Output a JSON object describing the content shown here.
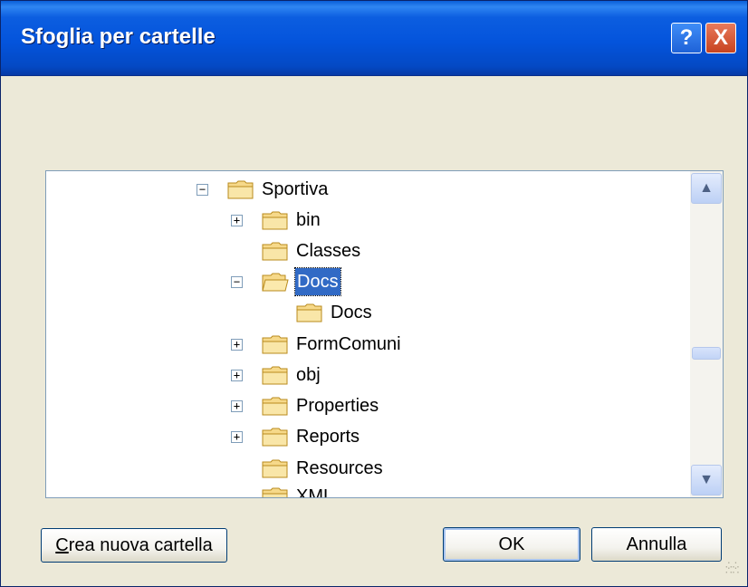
{
  "window": {
    "title": "Sfoglia per cartelle"
  },
  "titlebar_buttons": {
    "help": "?",
    "close": "X"
  },
  "tree": {
    "items": [
      {
        "label": "Sportiva",
        "expander": "−"
      },
      {
        "label": "bin",
        "expander": "+"
      },
      {
        "label": "Classes",
        "expander": ""
      },
      {
        "label": "Docs",
        "expander": "−",
        "selected": true
      },
      {
        "label": "Docs",
        "expander": ""
      },
      {
        "label": "FormComuni",
        "expander": "+"
      },
      {
        "label": "obj",
        "expander": "+"
      },
      {
        "label": "Properties",
        "expander": "+"
      },
      {
        "label": "Reports",
        "expander": "+"
      },
      {
        "label": "Resources",
        "expander": ""
      },
      {
        "label": "XML",
        "expander": ""
      }
    ]
  },
  "scrollbar": {
    "up": "▲",
    "down": "▼"
  },
  "buttons": {
    "create_prefix": "C",
    "create_rest": "rea nuova cartella",
    "ok": "OK",
    "cancel": "Annulla"
  },
  "colors": {
    "titlebar": "#0454dc",
    "selection": "#316ac5",
    "dialog_bg": "#ece9d8"
  }
}
